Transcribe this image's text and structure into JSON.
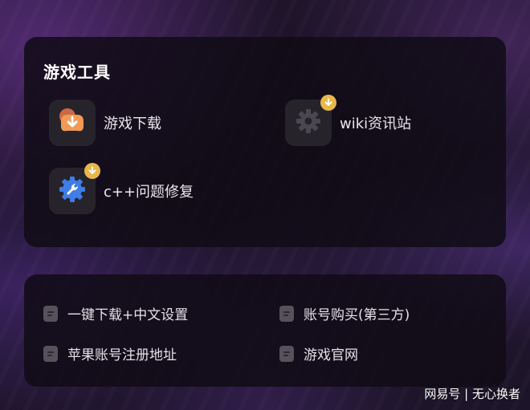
{
  "tools_panel": {
    "title": "游戏工具",
    "items": [
      {
        "label": "游戏下载",
        "icon": "game-download-icon",
        "has_badge": false
      },
      {
        "label": "wiki资讯站",
        "icon": "gear-icon",
        "has_badge": true
      },
      {
        "label": "c++问题修复",
        "icon": "wrench-gear-icon",
        "has_badge": true
      }
    ]
  },
  "links_panel": {
    "items": [
      {
        "label": "一键下载+中文设置"
      },
      {
        "label": "账号购买(第三方)"
      },
      {
        "label": "苹果账号注册地址"
      },
      {
        "label": "游戏官网"
      }
    ]
  },
  "watermark": "网易号 | 无心换者",
  "colors": {
    "panel_bg": "#100c16",
    "badge": "#e9b64a",
    "download_icon": "#f08a4b",
    "repair_icon": "#3f7de8"
  }
}
